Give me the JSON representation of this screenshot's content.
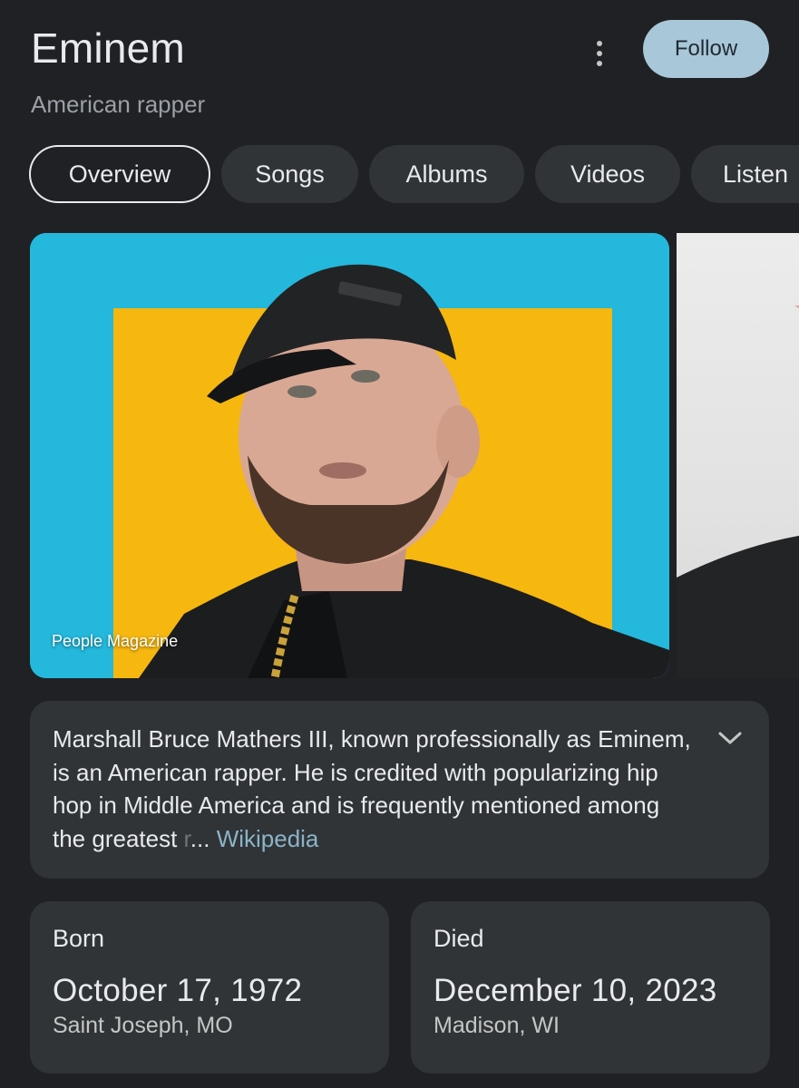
{
  "entity": {
    "name": "Eminem",
    "description": "American rapper"
  },
  "header": {
    "follow_label": "Follow",
    "more_icon": "more-vert-icon"
  },
  "tabs": [
    {
      "label": "Overview",
      "active": true
    },
    {
      "label": "Songs",
      "active": false
    },
    {
      "label": "Albums",
      "active": false
    },
    {
      "label": "Videos",
      "active": false
    },
    {
      "label": "Listen",
      "active": false
    }
  ],
  "images": {
    "main_credit": "People Magazine"
  },
  "summary": {
    "text": "Marshall Bruce Mathers III, known professionally as Eminem, is an American rapper. He is credited with popularizing hip hop in Middle America and is frequently mentioned among the greatest ",
    "faded_text": "r",
    "ellipsis": "...",
    "source_label": "Wikipedia",
    "expand_icon": "chevron-down-icon"
  },
  "facts": {
    "born": {
      "label": "Born",
      "date": "October 17, 1972",
      "place": "Saint Joseph, MO"
    },
    "died": {
      "label": "Died",
      "date": "December 10, 2023",
      "place": "Madison, WI"
    }
  },
  "colors": {
    "background": "#202124",
    "card": "#303436",
    "follow_button": "#a8c7d9",
    "link": "#8ab4c8"
  }
}
